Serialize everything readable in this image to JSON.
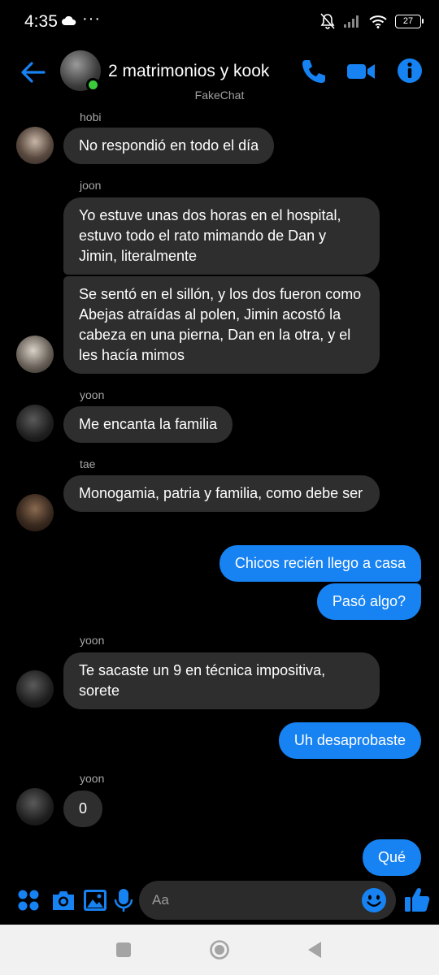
{
  "status_bar": {
    "time": "4:35",
    "dots": "···",
    "battery": "27"
  },
  "header": {
    "title": "2 matrimonios y kook",
    "subtitle": "FakeChat"
  },
  "colors": {
    "accent": "#1782f2",
    "incoming_bubble": "#2e2e2e",
    "online": "#3cc93c"
  },
  "messages": [
    {
      "sender": "hobi",
      "text": "No respondió en todo el día"
    },
    {
      "sender": "joon",
      "text": "Yo estuve unas dos horas en el hospital, estuvo todo el rato mimando de Dan y Jimin, literalmente"
    },
    {
      "text": "Se sentó en el sillón, y los dos fueron como Abejas atraídas al polen, Jimin acostó la cabeza en una pierna, Dan en la otra, y el les hacía mimos"
    },
    {
      "sender": "yoon",
      "text": "Me encanta la familia"
    },
    {
      "sender": "tae",
      "text": "Monogamia, patria y familia, como debe ser"
    },
    {
      "outgoing": true,
      "text": "Chicos recién llego a casa"
    },
    {
      "outgoing": true,
      "text": "Pasó algo?"
    },
    {
      "sender": "yoon",
      "text": "Te sacaste un 9 en técnica impositiva, sorete"
    },
    {
      "outgoing": true,
      "text": "Uh desaprobaste"
    },
    {
      "sender": "yoon",
      "text": "0"
    },
    {
      "outgoing": true,
      "text": "Qué"
    }
  ],
  "composer": {
    "placeholder": "Aa"
  },
  "icons": {
    "back": "arrow-left-icon",
    "call": "phone-icon",
    "video": "video-camera-icon",
    "info": "info-icon",
    "apps": "four-dots-icon",
    "camera": "camera-icon",
    "gallery": "image-icon",
    "mic": "microphone-icon",
    "emoji": "smiley-icon",
    "like": "thumbs-up-icon"
  }
}
